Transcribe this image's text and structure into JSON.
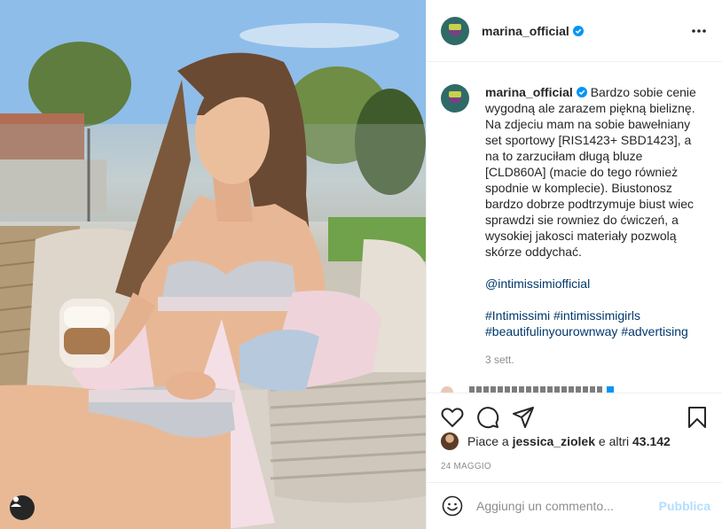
{
  "post": {
    "author": "marina_official",
    "more_icon": "more-options-icon",
    "verified_icon": "verified-badge-icon"
  },
  "caption": {
    "username": "marina_official",
    "lines": [
      "Bardzo sobie cenie",
      "wygodną ale zarazem piękną bieliznę.",
      "Na zdjeciu mam na sobie bawełniany",
      "set sportowy [RIS1423+ SBD1423], a",
      "na to zarzuciłam długą bluze",
      "[CLD860A] (macie do tego również",
      "spodnie w komplecie). Biustonosz",
      "bardzo dobrze podtrzymuje biust wiec",
      "sprawdzi sie rowniez do ćwiczeń, a",
      "wysokiej jakosci materiały pozwolą",
      "skórze oddychać."
    ],
    "mention": "@intimissimiofficial",
    "hashtags_line1": "#Intimissimi #intimissimigirls",
    "hashtags_line2": "#beautifulinyourownway #advertising",
    "time": "3 sett."
  },
  "actions": {
    "like_icon": "heart-icon",
    "comment_icon": "comment-icon",
    "share_icon": "share-icon",
    "save_icon": "bookmark-icon"
  },
  "likes": {
    "prefix": "Piace a ",
    "liker": "jessica_ziolek",
    "middle": " e altri ",
    "count": "43.142"
  },
  "date": "24 MAGGIO",
  "comment_box": {
    "placeholder": "Aggiungi un commento...",
    "post_label": "Pubblica"
  },
  "photo": {
    "tag_icon": "user-tag-icon"
  },
  "colors": {
    "link": "#00376b",
    "verified": "#0095f6",
    "post_button_disabled": "#b2dffc",
    "muted": "#8e8e8e"
  }
}
